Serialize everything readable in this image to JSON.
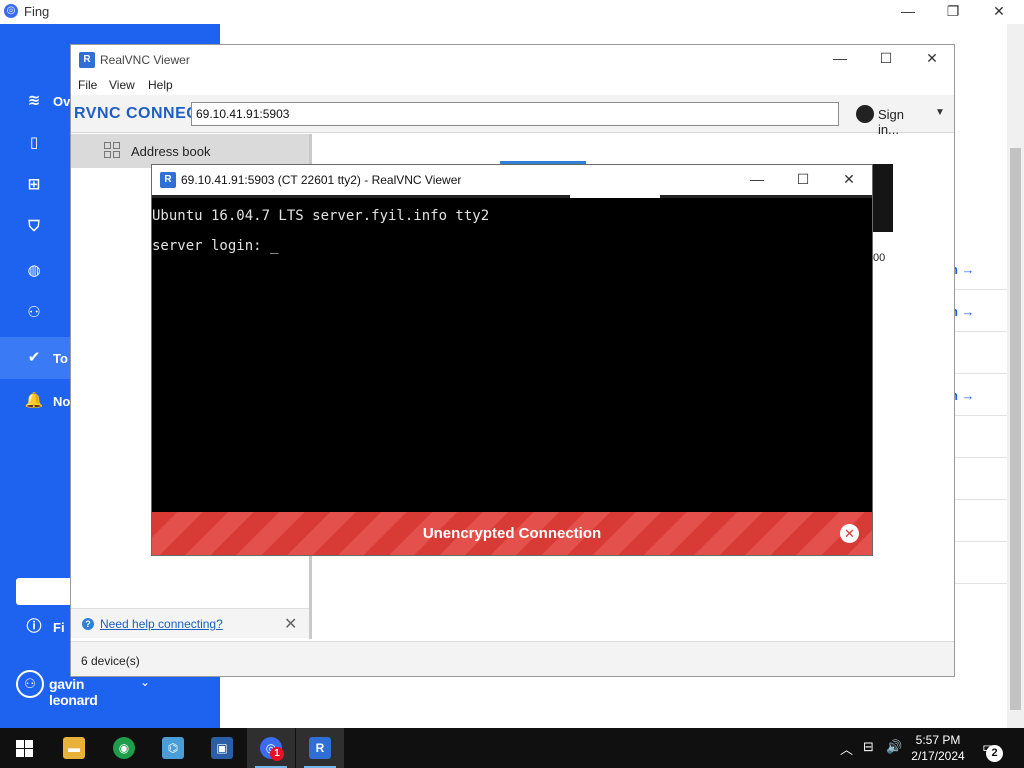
{
  "fing": {
    "title": "Fing",
    "nav": [
      {
        "label": "Ov",
        "icon": "wifi-icon",
        "glyph": "≋"
      },
      {
        "label": "",
        "icon": "device-icon",
        "glyph": "▯"
      },
      {
        "label": "",
        "icon": "network-icon",
        "glyph": "⊞"
      },
      {
        "label": "",
        "icon": "shield-icon",
        "glyph": "⛉"
      },
      {
        "label": "",
        "icon": "globe-icon",
        "glyph": "◍"
      },
      {
        "label": "",
        "icon": "users-icon",
        "glyph": "⚇"
      },
      {
        "label": "To",
        "icon": "check-circle-icon",
        "glyph": "✔"
      },
      {
        "label": "No",
        "icon": "bell-icon",
        "glyph": "🔔"
      },
      {
        "label": "Fi",
        "icon": "info-icon",
        "glyph": "ⓘ"
      }
    ],
    "user": {
      "name": "gavin leonard"
    },
    "links": [
      {
        "label": "n →"
      },
      {
        "label": "n →"
      },
      {
        "label": "n →"
      }
    ],
    "colors": {
      "sidebar": "#1e63f0",
      "active": "#3a7bf5"
    }
  },
  "vnc": {
    "title": "RealVNC Viewer",
    "menu": [
      "File",
      "View",
      "Help"
    ],
    "brand": "RVNC CONNECT",
    "address": "69.10.41.91:5903",
    "signin": "Sign in...",
    "address_book": "Address book",
    "help_link": "Need help connecting?",
    "status": "6 device(s)",
    "thumb_label": "00"
  },
  "session": {
    "title": "69.10.41.91:5903 (CT 22601 tty2) - RealVNC Viewer",
    "terminal": [
      "Ubuntu 16.04.7 LTS server.fyil.info tty2",
      "server login: _"
    ],
    "banner": "Unencrypted Connection",
    "colors": {
      "banner": "#d83a36"
    }
  },
  "taskbar": {
    "apps": [
      {
        "name": "file-explorer",
        "glyph": "▬",
        "color": "#e8b23a"
      },
      {
        "name": "chrome",
        "glyph": "◉",
        "color": "#1e9e4a"
      },
      {
        "name": "network-app",
        "glyph": "⌬",
        "color": "#4a9ed8"
      },
      {
        "name": "remote-desktop",
        "glyph": "▣",
        "color": "#2a5fa8"
      },
      {
        "name": "fing",
        "glyph": "◎",
        "color": "#3b6cf0"
      },
      {
        "name": "realvnc",
        "glyph": "R",
        "color": "#2f6fd6"
      }
    ],
    "badge": "1",
    "time": "5:57 PM",
    "date": "2/17/2024",
    "notifications": "2"
  }
}
